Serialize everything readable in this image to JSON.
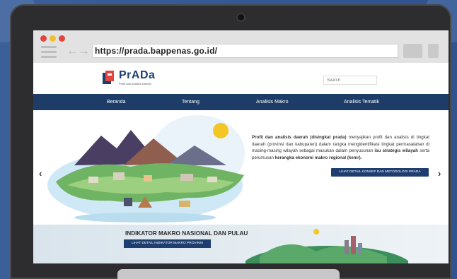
{
  "browser": {
    "url": "https://prada.bappenas.go.id/",
    "traffic_lights": [
      "#e0443e",
      "#f1be32",
      "#27c840"
    ]
  },
  "site": {
    "logo_text": "PrADa",
    "logo_subtitle": "Profil dan Analisis Daerah",
    "search_placeholder": "Search"
  },
  "nav": {
    "items": [
      "Beranda",
      "Tentang",
      "Analisis Makro",
      "Analisis Tematik"
    ]
  },
  "hero": {
    "description_bold": "Profil dan analisis daerah (disingkat prada)",
    "description_1": " menyajikan profil dan analisis di tingkat daerah (provinsi dan kabupaten) dalam rangka mengidentifikasi tingkat permasalahan di masing-masing wilayah sebagai masukan dalam penyusunan ",
    "description_bold_2": "isu strategis wilayah",
    "description_2": " serta perumusan ",
    "description_bold_3": "kerangka ekonomi makro regional (kemr).",
    "button_label": "LIHAT DETAIL KONSEP DAN METODOLOGI PRADA",
    "prev_arrow": "‹",
    "next_arrow": "›"
  },
  "indicator": {
    "title": "INDIKATOR MAKRO NASIONAL DAN PULAU",
    "button_label": "LIHAT DETAIL INDIKATOR MAKRO PROVINSI"
  },
  "colors": {
    "navy": "#1d3d68",
    "background": "#3a5f99"
  }
}
